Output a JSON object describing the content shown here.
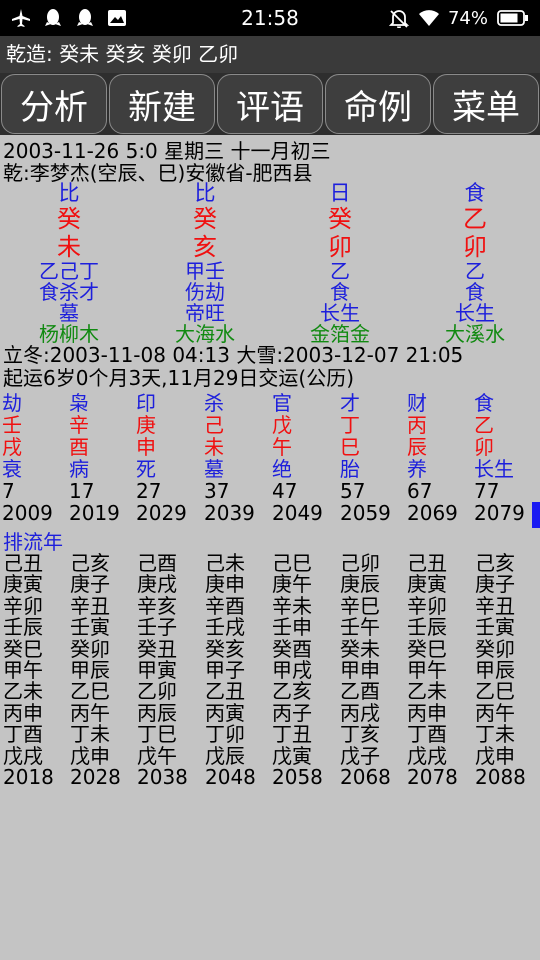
{
  "status": {
    "time": "21:58",
    "battery": "74%",
    "left_icons": [
      "airplane-icon",
      "penguin-icon",
      "penguin-icon",
      "image-icon"
    ],
    "right_icons": [
      "alarm-off-icon",
      "wifi-icon",
      "battery-icon"
    ]
  },
  "title": "乾造: 癸未   癸亥   癸卯   乙卯",
  "tabs": [
    "分析",
    "新建",
    "评语",
    "命例",
    "菜单"
  ],
  "info": {
    "date_line": "2003-11-26 5:0  星期三  十一月初三",
    "person_line": "乾:李梦杰(空辰、巳)安徽省-肥西县"
  },
  "pillars": [
    {
      "god": "比",
      "stem": "癸",
      "branch": "未",
      "hidden": "乙己丁",
      "hidden_gods": "食杀才",
      "stage": "墓",
      "nayin": "杨柳木",
      "god_color": "#1d1fdc",
      "stem_color": "#f01010",
      "branch_color": "#f01010"
    },
    {
      "god": "比",
      "stem": "癸",
      "branch": "亥",
      "hidden": "甲壬",
      "hidden_gods": "伤劫",
      "stage": "帝旺",
      "nayin": "大海水",
      "god_color": "#1d1fdc",
      "stem_color": "#f01010",
      "branch_color": "#f01010"
    },
    {
      "god": "日",
      "stem": "癸",
      "branch": "卯",
      "hidden": "乙",
      "hidden_gods": "食",
      "stage": "长生",
      "nayin": "金箔金",
      "god_color": "#1d1fdc",
      "stem_color": "#f01010",
      "branch_color": "#f01010"
    },
    {
      "god": "食",
      "stem": "乙",
      "branch": "卯",
      "hidden": "乙",
      "hidden_gods": "食",
      "stage": "长生",
      "nayin": "大溪水",
      "god_color": "#1d1fdc",
      "stem_color": "#f01010",
      "branch_color": "#f01010"
    }
  ],
  "terms_line": "立冬:2003-11-08 04:13  大雪:2003-12-07 21:05",
  "qiyun_line": "起运6岁0个月3天,11月29日交运(公历)",
  "dayun": [
    {
      "god": "劫",
      "stem": "壬",
      "branch": "戌",
      "stage": "衰",
      "age": "7",
      "year": "2009"
    },
    {
      "god": "枭",
      "stem": "辛",
      "branch": "酉",
      "stage": "病",
      "age": "17",
      "year": "2019"
    },
    {
      "god": "印",
      "stem": "庚",
      "branch": "申",
      "stage": "死",
      "age": "27",
      "year": "2029"
    },
    {
      "god": "杀",
      "stem": "己",
      "branch": "未",
      "stage": "墓",
      "age": "37",
      "year": "2039"
    },
    {
      "god": "官",
      "stem": "戊",
      "branch": "午",
      "stage": "绝",
      "age": "47",
      "year": "2049"
    },
    {
      "god": "才",
      "stem": "丁",
      "branch": "巳",
      "stage": "胎",
      "age": "57",
      "year": "2059"
    },
    {
      "god": "财",
      "stem": "丙",
      "branch": "辰",
      "stage": "养",
      "age": "67",
      "year": "2069"
    },
    {
      "god": "食",
      "stem": "乙",
      "branch": "卯",
      "stage": "长生",
      "age": "77",
      "year": "2079"
    }
  ],
  "liunian_label": "排流年",
  "liunian": [
    {
      "items": [
        "己丑",
        "庚寅",
        "辛卯",
        "壬辰",
        "癸巳",
        "甲午",
        "乙未",
        "丙申",
        "丁酉",
        "戊戌"
      ],
      "end_year": "2018"
    },
    {
      "items": [
        "己亥",
        "庚子",
        "辛丑",
        "壬寅",
        "癸卯",
        "甲辰",
        "乙巳",
        "丙午",
        "丁未",
        "戊申"
      ],
      "end_year": "2028"
    },
    {
      "items": [
        "己酉",
        "庚戌",
        "辛亥",
        "壬子",
        "癸丑",
        "甲寅",
        "乙卯",
        "丙辰",
        "丁巳",
        "戊午"
      ],
      "end_year": "2038"
    },
    {
      "items": [
        "己未",
        "庚申",
        "辛酉",
        "壬戌",
        "癸亥",
        "甲子",
        "乙丑",
        "丙寅",
        "丁卯",
        "戊辰"
      ],
      "end_year": "2048"
    },
    {
      "items": [
        "己巳",
        "庚午",
        "辛未",
        "壬申",
        "癸酉",
        "甲戌",
        "乙亥",
        "丙子",
        "丁丑",
        "戊寅"
      ],
      "end_year": "2058"
    },
    {
      "items": [
        "己卯",
        "庚辰",
        "辛巳",
        "壬午",
        "癸未",
        "甲申",
        "乙酉",
        "丙戌",
        "丁亥",
        "戊子"
      ],
      "end_year": "2068"
    },
    {
      "items": [
        "己丑",
        "庚寅",
        "辛卯",
        "壬辰",
        "癸巳",
        "甲午",
        "乙未",
        "丙申",
        "丁酉",
        "戊戌"
      ],
      "end_year": "2078"
    },
    {
      "items": [
        "己亥",
        "庚子",
        "辛丑",
        "壬寅",
        "癸卯",
        "甲辰",
        "乙巳",
        "丙午",
        "丁未",
        "戊申"
      ],
      "end_year": "2088"
    }
  ]
}
